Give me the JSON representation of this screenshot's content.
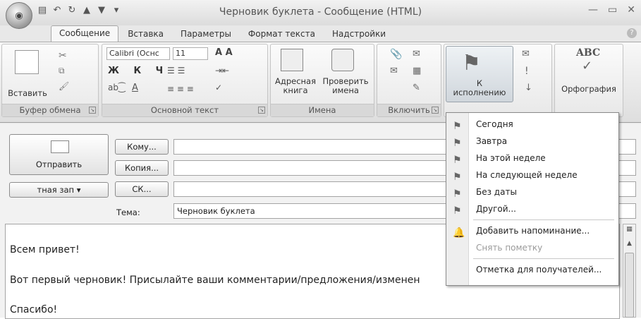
{
  "window": {
    "title": "Черновик буклета - Сообщение (HTML)",
    "office_button": "O"
  },
  "qat": [
    "save-icon",
    "undo-icon",
    "redo-icon",
    "prev-icon",
    "next-icon",
    "qat-dropdown-icon"
  ],
  "tabs": [
    "Сообщение",
    "Вставка",
    "Параметры",
    "Формат текста",
    "Надстройки"
  ],
  "ribbon": {
    "clipboard": {
      "label": "Буфер обмена",
      "paste": "Вставить"
    },
    "text": {
      "label": "Основной текст",
      "font": "Calibri (Оснс",
      "size": "11"
    },
    "names": {
      "label": "Имена",
      "address": "Адресная\nкнига",
      "check": "Проверить\nимена"
    },
    "include": {
      "label": "Включить"
    },
    "followup": {
      "label": "К\nисполнению"
    },
    "spelling": {
      "label": "Орфография",
      "abc": "ABC"
    }
  },
  "compose": {
    "send": "Отправить",
    "to": "Кому...",
    "cc": "Копия...",
    "bcc": "СК...",
    "account": "тная зап",
    "subject_label": "Тема:",
    "subject_value": "Черновик буклета"
  },
  "body": {
    "line1": "Всем привет!",
    "line2": "Вот первый черновик! Присылайте ваши комментарии/предложения/изменен",
    "line3": "Спасибо!"
  },
  "menu": {
    "items": [
      {
        "label": "Сегодня"
      },
      {
        "label": "Завтра"
      },
      {
        "label": "На этой неделе"
      },
      {
        "label": "На следующей неделе"
      },
      {
        "label": "Без даты"
      },
      {
        "label": "Другой..."
      },
      {
        "label": "Добавить напоминание..."
      },
      {
        "label": "Снять пометку"
      },
      {
        "label": "Отметка для получателей..."
      }
    ]
  }
}
